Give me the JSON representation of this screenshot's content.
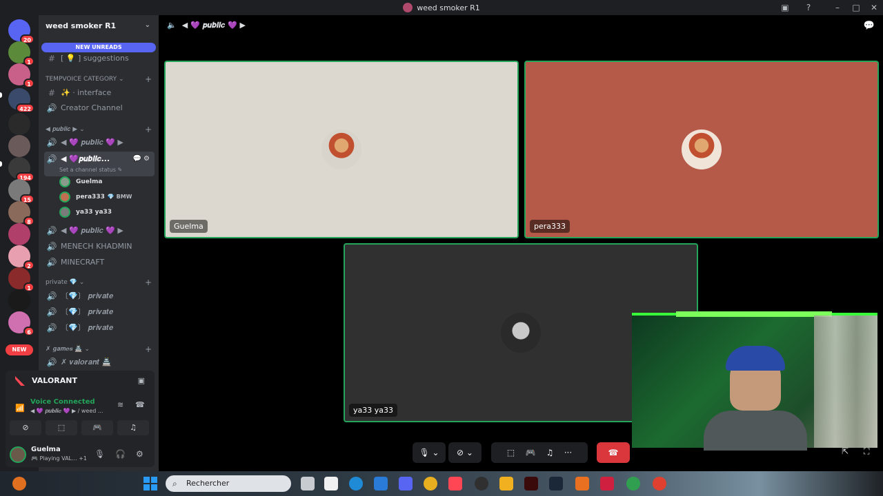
{
  "window": {
    "title": "weed smoker R1"
  },
  "rail": {
    "badges": [
      "20",
      "1",
      "1",
      "422",
      "194",
      "15",
      "8",
      "2",
      "1",
      "6"
    ],
    "new_label": "NEW"
  },
  "sidebar": {
    "guild_name": "weed smoker R1",
    "new_unreads": "NEW UNREADS",
    "channels_top": [
      {
        "icon": "💡",
        "label": "[ 💡 ] suggestions"
      }
    ],
    "tempvoice_category": "TEMPVOICE CATEGORY",
    "tempvoice_items": [
      "✨ · interface",
      "Creator Channel"
    ],
    "public_category": "◀ 𝒑𝒖𝒃𝒍𝒊𝒄 ▶",
    "public_items": [
      "◀ 💜 𝒑𝒖𝒃𝒍𝒊𝒄 💜 ▶"
    ],
    "active_channel": {
      "label": "◀ 💜𝒑𝒖𝒃𝒍𝒊𝒄...",
      "status": "Set a channel status ✎"
    },
    "members": [
      {
        "name": "Guelma",
        "tag": ""
      },
      {
        "name": "pera333",
        "tag": "💎 BMW"
      },
      {
        "name": "ya33 ya33",
        "tag": ""
      }
    ],
    "more_voice": [
      "◀ 💜 𝒑𝒖𝒃𝒍𝒊𝒄 💜 ▶",
      "MENECH KHADMIN",
      "MINECRAFT"
    ],
    "private_category": "private 💎",
    "private_items": [
      "〔💎〕 𝒑𝒓𝒊𝒗𝒂𝒕𝒆",
      "〔💎〕 𝒑𝒓𝒊𝒗𝒂𝒕𝒆",
      "〔💎〕 𝒑𝒓𝒊𝒗𝒂𝒕𝒆"
    ],
    "games_category": "✗ 𝒈𝒂𝒎𝒆𝒔 🏯",
    "games_items": [
      "✗ 𝒗𝒂𝒍𝒐𝒓𝒂𝒏𝒕 🏯"
    ]
  },
  "activity": {
    "label": "VALORANT"
  },
  "voice": {
    "status": "Voice Connected",
    "channel": "◀ 💜 𝒑𝒖𝒃𝒍𝒊𝒄 💜 ▶ / weed ..."
  },
  "user": {
    "name": "Guelma",
    "status": "Playing VAL...",
    "extra": "+1"
  },
  "stage": {
    "header": "◀ 💜 𝒑𝒖𝒃𝒍𝒊𝒄 💜 ▶",
    "tiles": [
      {
        "name": "Guelma",
        "bg": "#dcd8cf"
      },
      {
        "name": "pera333",
        "bg": "#b55a48"
      },
      {
        "name": "ya33 ya33",
        "bg": "#303030"
      }
    ]
  },
  "taskbar": {
    "search_placeholder": "Rechercher"
  },
  "colors": {
    "accent": "#5865f2",
    "online": "#23a55a",
    "danger": "#da373c"
  }
}
